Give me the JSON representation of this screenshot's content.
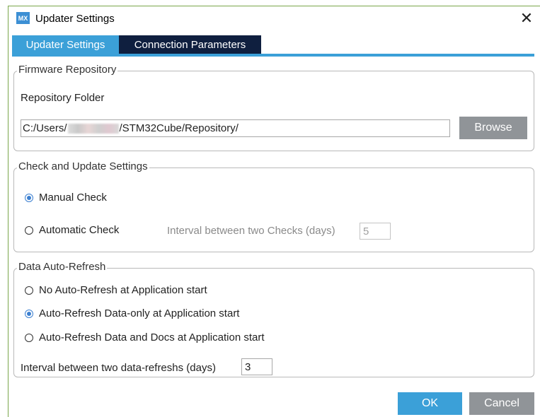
{
  "window": {
    "icon_text": "MX",
    "title": "Updater Settings",
    "close_glyph": "✕"
  },
  "tabs": [
    {
      "label": "Updater Settings",
      "active": true
    },
    {
      "label": "Connection Parameters",
      "active": false
    }
  ],
  "firmware_repository": {
    "legend": "Firmware Repository",
    "folder_label": "Repository Folder",
    "path_prefix": "C:/Users/",
    "path_suffix": "/STM32Cube/Repository/",
    "browse_label": "Browse"
  },
  "check_update": {
    "legend": "Check and Update Settings",
    "manual_label": "Manual Check",
    "manual_checked": true,
    "automatic_label": "Automatic Check",
    "automatic_checked": false,
    "interval_label": "Interval between two Checks (days)",
    "interval_value": "5"
  },
  "auto_refresh": {
    "legend": "Data Auto-Refresh",
    "options": [
      {
        "label": "No Auto-Refresh at Application start",
        "checked": false
      },
      {
        "label": "Auto-Refresh Data-only at Application start",
        "checked": true
      },
      {
        "label": "Auto-Refresh Data and Docs at Application start",
        "checked": false
      }
    ],
    "interval_label": "Interval between two data-refreshs (days)",
    "interval_value": "3"
  },
  "footer": {
    "ok_label": "OK",
    "cancel_label": "Cancel"
  },
  "colors": {
    "accent": "#3ba0d8",
    "tab_dark": "#0f1f3f",
    "button_gray": "#909498",
    "radio_selected": "#3b7fd0"
  }
}
